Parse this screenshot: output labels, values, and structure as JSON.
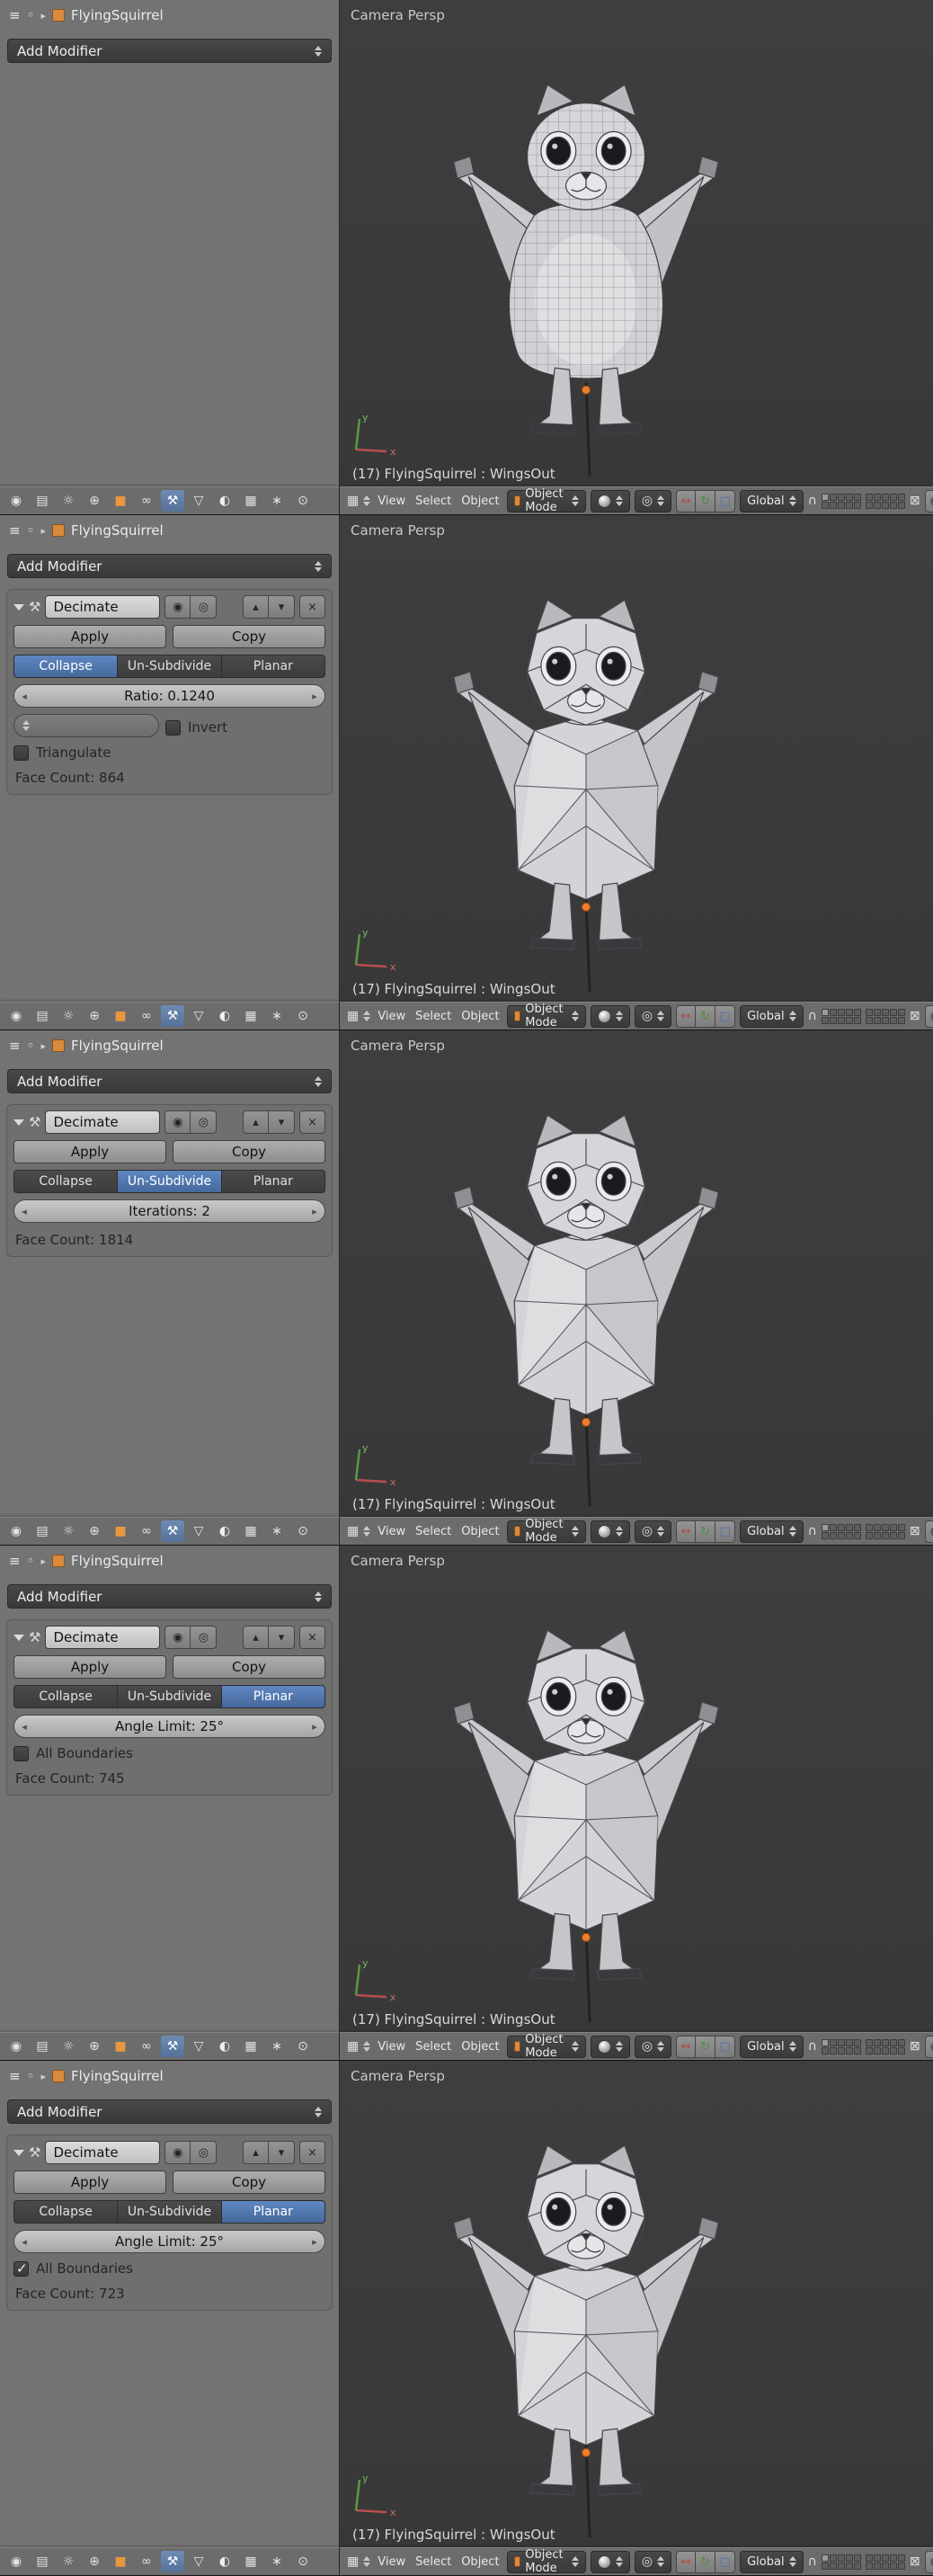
{
  "colors": {
    "accent_blue": "#5680c2",
    "object_orange": "#d98a3d",
    "viewport_bg": "#3b3b3b",
    "panel_bg": "#737373",
    "origin_dot": "#ed7f31"
  },
  "breadcrumb": {
    "object_name": "FlyingSquirrel"
  },
  "properties": {
    "add_modifier": "Add Modifier"
  },
  "modifier": {
    "name": "Decimate",
    "apply": "Apply",
    "copy": "Copy",
    "modes": [
      "Collapse",
      "Un-Subdivide",
      "Planar"
    ]
  },
  "viewport": {
    "view_label": "Camera Persp",
    "object_info": "(17) FlyingSquirrel : WingsOut",
    "menus": [
      "View",
      "Select",
      "Object"
    ],
    "mode": "Object Mode",
    "orientation": "Global"
  },
  "sections": [
    {
      "modifier_shown": false
    },
    {
      "modifier_shown": true,
      "active_mode": "Collapse",
      "field_value": "Ratio: 0.1240",
      "invert_label": "Invert",
      "invert_checked": "false",
      "triangulate_label": "Triangulate",
      "triangulate_checked": "false",
      "face_count": "Face Count: 864"
    },
    {
      "modifier_shown": true,
      "active_mode": "Un-Subdivide",
      "field_value": "Iterations: 2",
      "face_count": "Face Count: 1814"
    },
    {
      "modifier_shown": true,
      "active_mode": "Planar",
      "field_value": "Angle Limit: 25°",
      "all_boundaries_label": "All Boundaries",
      "all_boundaries_checked": "false",
      "face_count": "Face Count: 745"
    },
    {
      "modifier_shown": true,
      "active_mode": "Planar",
      "field_value": "Angle Limit: 25°",
      "all_boundaries_label": "All Boundaries",
      "all_boundaries_checked": "true",
      "face_count": "Face Count: 723"
    }
  ],
  "icons": {
    "editor_menu": "≡",
    "pin": "◦",
    "crumb_arrow": "▸",
    "wrench": "⚒",
    "render_toggle": "◉",
    "eye_toggle": "◎",
    "up": "▴",
    "down": "▾",
    "close": "×",
    "dec": "◂",
    "inc": "▸",
    "tab_render": "◉",
    "tab_render_layers": "▤",
    "tab_scene": "☼",
    "tab_world": "⊕",
    "tab_object": "■",
    "tab_constraints": "∞",
    "tab_modifiers": "⚒",
    "tab_data": "▽",
    "tab_material": "◐",
    "tab_texture": "▦",
    "tab_particles": "∗",
    "tab_physics": "⊙",
    "vp_editor": "▦",
    "pivot": "◎",
    "manip_translate": "↔",
    "manip_rotate": "↻",
    "manip_scale": "□",
    "magnet": "∩",
    "lock": "⊠",
    "render_still": "◉",
    "render_anim": "▸"
  }
}
